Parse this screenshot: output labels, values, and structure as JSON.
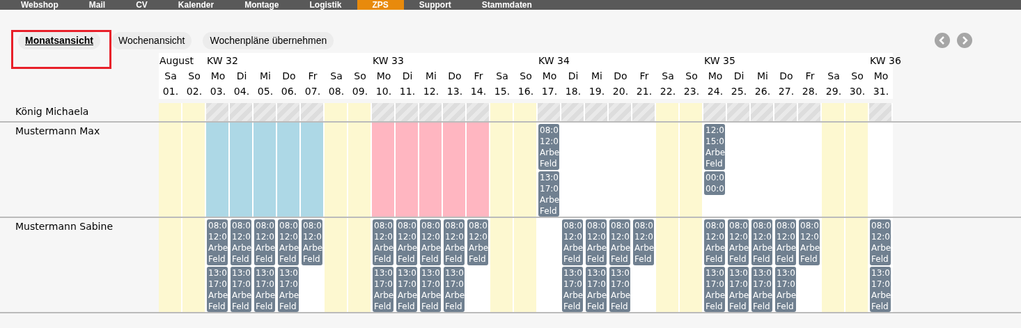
{
  "nav": [
    {
      "label": "Webshop",
      "selected": false
    },
    {
      "label": "Mail",
      "selected": false
    },
    {
      "label": "CV",
      "selected": false
    },
    {
      "label": "Kalender",
      "selected": false
    },
    {
      "label": "Montage",
      "selected": false
    },
    {
      "label": "Logistik",
      "selected": false
    },
    {
      "label": "ZPS",
      "selected": true
    },
    {
      "label": "Support",
      "selected": false
    },
    {
      "label": "Stammdaten",
      "selected": false
    }
  ],
  "views": [
    {
      "label": "Monatsansicht",
      "selected": true
    },
    {
      "label": "Wochenansicht",
      "selected": false
    },
    {
      "label": "Wochenpläne übernehmen",
      "selected": false
    }
  ],
  "days": [
    {
      "top": "August",
      "name": "Sa",
      "date": "01."
    },
    {
      "name": "So",
      "date": "02."
    },
    {
      "top": "KW 32",
      "name": "Mo",
      "date": "03."
    },
    {
      "name": "Di",
      "date": "04."
    },
    {
      "name": "Mi",
      "date": "05."
    },
    {
      "name": "Do",
      "date": "06."
    },
    {
      "name": "Fr",
      "date": "07."
    },
    {
      "name": "Sa",
      "date": "08."
    },
    {
      "name": "So",
      "date": "09."
    },
    {
      "top": "KW 33",
      "name": "Mo",
      "date": "10."
    },
    {
      "name": "Di",
      "date": "11."
    },
    {
      "name": "Mi",
      "date": "12."
    },
    {
      "name": "Do",
      "date": "13."
    },
    {
      "name": "Fr",
      "date": "14."
    },
    {
      "name": "Sa",
      "date": "15."
    },
    {
      "name": "So",
      "date": "16."
    },
    {
      "top": "KW 34",
      "name": "Mo",
      "date": "17."
    },
    {
      "name": "Di",
      "date": "18."
    },
    {
      "name": "Mi",
      "date": "19."
    },
    {
      "name": "Do",
      "date": "20."
    },
    {
      "name": "Fr",
      "date": "21."
    },
    {
      "name": "Sa",
      "date": "22."
    },
    {
      "name": "So",
      "date": "23."
    },
    {
      "top": "KW 35",
      "name": "Mo",
      "date": "24."
    },
    {
      "name": "Di",
      "date": "25."
    },
    {
      "name": "Mi",
      "date": "26."
    },
    {
      "name": "Do",
      "date": "27."
    },
    {
      "name": "Fr",
      "date": "28."
    },
    {
      "name": "Sa",
      "date": "29."
    },
    {
      "name": "So",
      "date": "30."
    },
    {
      "top": "KW 36",
      "name": "Mo",
      "date": "31."
    }
  ],
  "people": [
    {
      "name": "König Michaela",
      "kind": "short",
      "cells": [
        {
          "kind": "weekend"
        },
        {
          "kind": "weekend"
        },
        {
          "kind": "blocked"
        },
        {
          "kind": "blocked"
        },
        {
          "kind": "blocked"
        },
        {
          "kind": "blocked"
        },
        {
          "kind": "blocked"
        },
        {
          "kind": "weekend"
        },
        {
          "kind": "weekend"
        },
        {
          "kind": "blocked"
        },
        {
          "kind": "blocked"
        },
        {
          "kind": "blocked"
        },
        {
          "kind": "blocked"
        },
        {
          "kind": "blocked"
        },
        {
          "kind": "weekend"
        },
        {
          "kind": "weekend"
        },
        {
          "kind": "blocked"
        },
        {
          "kind": "blocked"
        },
        {
          "kind": "blocked"
        },
        {
          "kind": "blocked"
        },
        {
          "kind": "blocked"
        },
        {
          "kind": "weekend"
        },
        {
          "kind": "weekend"
        },
        {
          "kind": "blocked"
        },
        {
          "kind": "blocked"
        },
        {
          "kind": "blocked"
        },
        {
          "kind": "blocked"
        },
        {
          "kind": "blocked"
        },
        {
          "kind": "weekend"
        },
        {
          "kind": "weekend"
        },
        {
          "kind": "blocked"
        }
      ]
    },
    {
      "name": "Mustermann Max",
      "kind": "tall",
      "cells": [
        {
          "kind": "weekend"
        },
        {
          "kind": "weekend"
        },
        {
          "kind": "absence",
          "color": "#add8e6"
        },
        {
          "kind": "absence",
          "color": "#add8e6"
        },
        {
          "kind": "absence",
          "color": "#add8e6"
        },
        {
          "kind": "absence",
          "color": "#add8e6"
        },
        {
          "kind": "absence",
          "color": "#add8e6"
        },
        {
          "kind": "weekend"
        },
        {
          "kind": "weekend"
        },
        {
          "kind": "absence",
          "color": "#ffb6c1"
        },
        {
          "kind": "absence",
          "color": "#ffb6c1"
        },
        {
          "kind": "absence",
          "color": "#ffb6c1"
        },
        {
          "kind": "absence",
          "color": "#ffb6c1"
        },
        {
          "kind": "absence",
          "color": "#ffb6c1"
        },
        {
          "kind": "weekend"
        },
        {
          "kind": "weekend"
        },
        {
          "kind": "free",
          "entries": [
            [
              "08:0",
              "12:0",
              "Arbe",
              "Feld"
            ],
            [
              "13:0",
              "17:0",
              "Arbe",
              "Feld"
            ]
          ]
        },
        {
          "kind": "free"
        },
        {
          "kind": "free"
        },
        {
          "kind": "free"
        },
        {
          "kind": "free"
        },
        {
          "kind": "weekend"
        },
        {
          "kind": "weekend"
        },
        {
          "kind": "free",
          "entries": [
            [
              "12:0",
              "15:0",
              "Arbe",
              "Feld"
            ],
            [
              "00:0",
              "00:0"
            ]
          ]
        },
        {
          "kind": "free"
        },
        {
          "kind": "free"
        },
        {
          "kind": "free"
        },
        {
          "kind": "free"
        },
        {
          "kind": "weekend"
        },
        {
          "kind": "weekend"
        },
        {
          "kind": "free"
        }
      ]
    },
    {
      "name": "Mustermann Sabine",
      "kind": "tall",
      "cells": [
        {
          "kind": "weekend"
        },
        {
          "kind": "weekend"
        },
        {
          "kind": "free",
          "entries": [
            [
              "08:0",
              "12:0",
              "Arbe",
              "Feld"
            ],
            [
              "13:0",
              "17:0",
              "Arbe",
              "Feld"
            ]
          ]
        },
        {
          "kind": "free",
          "entries": [
            [
              "08:0",
              "12:0",
              "Arbe",
              "Feld"
            ],
            [
              "13:0",
              "17:0",
              "Arbe",
              "Feld"
            ]
          ]
        },
        {
          "kind": "free",
          "entries": [
            [
              "08:0",
              "12:0",
              "Arbe",
              "Feld"
            ],
            [
              "13:0",
              "17:0",
              "Arbe",
              "Feld"
            ]
          ]
        },
        {
          "kind": "free",
          "entries": [
            [
              "08:0",
              "12:0",
              "Arbe",
              "Feld"
            ],
            [
              "13:0",
              "17:0",
              "Arbe",
              "Feld"
            ]
          ]
        },
        {
          "kind": "free",
          "entries": [
            [
              "08:0",
              "12:0",
              "Arbe",
              "Feld"
            ]
          ]
        },
        {
          "kind": "weekend"
        },
        {
          "kind": "weekend"
        },
        {
          "kind": "free",
          "entries": [
            [
              "08:0",
              "12:0",
              "Arbe",
              "Feld"
            ],
            [
              "13:0",
              "17:0",
              "Arbe",
              "Feld"
            ]
          ]
        },
        {
          "kind": "free",
          "entries": [
            [
              "08:0",
              "12:0",
              "Arbe",
              "Feld"
            ],
            [
              "13:0",
              "17:0",
              "Arbe",
              "Feld"
            ]
          ]
        },
        {
          "kind": "free",
          "entries": [
            [
              "08:0",
              "12:0",
              "Arbe",
              "Feld"
            ],
            [
              "13:0",
              "17:0",
              "Arbe",
              "Feld"
            ]
          ]
        },
        {
          "kind": "free",
          "entries": [
            [
              "08:0",
              "12:0",
              "Arbe",
              "Feld"
            ],
            [
              "13:0",
              "17:0",
              "Arbe",
              "Feld"
            ]
          ]
        },
        {
          "kind": "free",
          "entries": [
            [
              "08:0",
              "12:0",
              "Arbe",
              "Feld"
            ]
          ]
        },
        {
          "kind": "weekend"
        },
        {
          "kind": "weekend"
        },
        {
          "kind": "free"
        },
        {
          "kind": "free",
          "entries": [
            [
              "08:0",
              "12:0",
              "Arbe",
              "Feld"
            ],
            [
              "13:0",
              "17:0",
              "Arbe",
              "Feld"
            ]
          ]
        },
        {
          "kind": "free",
          "entries": [
            [
              "08:0",
              "12:0",
              "Arbe",
              "Feld"
            ],
            [
              "13:0",
              "17:0",
              "Arbe",
              "Feld"
            ]
          ]
        },
        {
          "kind": "free",
          "entries": [
            [
              "08:0",
              "12:0",
              "Arbe",
              "Feld"
            ],
            [
              "13:0",
              "17:0",
              "Arbe",
              "Feld"
            ]
          ]
        },
        {
          "kind": "free",
          "entries": [
            [
              "08:0",
              "12:0",
              "Arbe",
              "Feld"
            ]
          ]
        },
        {
          "kind": "weekend"
        },
        {
          "kind": "weekend"
        },
        {
          "kind": "free",
          "entries": [
            [
              "08:0",
              "12:0",
              "Arbe",
              "Feld"
            ],
            [
              "13:0",
              "17:0",
              "Arbe",
              "Feld"
            ]
          ]
        },
        {
          "kind": "free",
          "entries": [
            [
              "08:0",
              "12:0",
              "Arbe",
              "Feld"
            ],
            [
              "13:0",
              "17:0",
              "Arbe",
              "Feld"
            ]
          ]
        },
        {
          "kind": "free",
          "entries": [
            [
              "08:0",
              "12:0",
              "Arbe",
              "Feld"
            ],
            [
              "13:0",
              "17:0",
              "Arbe",
              "Feld"
            ]
          ]
        },
        {
          "kind": "free",
          "entries": [
            [
              "08:0",
              "12:0",
              "Arbe",
              "Feld"
            ],
            [
              "13:0",
              "17:0",
              "Arbe",
              "Feld"
            ]
          ]
        },
        {
          "kind": "free",
          "entries": [
            [
              "08:0",
              "12:0",
              "Arbe",
              "Feld"
            ]
          ]
        },
        {
          "kind": "weekend"
        },
        {
          "kind": "weekend"
        },
        {
          "kind": "free",
          "entries": [
            [
              "08:0",
              "12:0",
              "Arbe",
              "Feld"
            ],
            [
              "13:0",
              "17:0",
              "Arbe",
              "Feld"
            ]
          ]
        }
      ]
    }
  ]
}
